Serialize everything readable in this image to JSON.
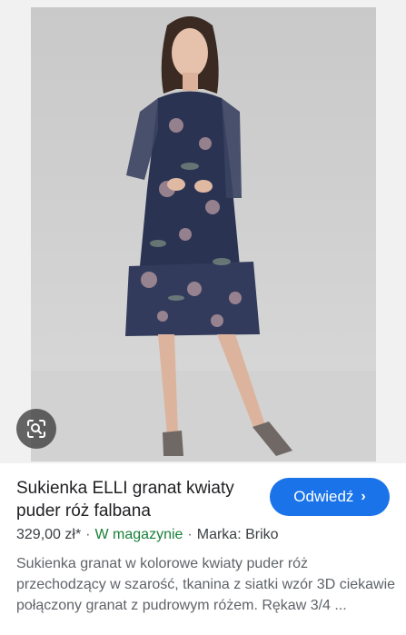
{
  "product": {
    "title": "Sukienka ELLI granat kwiaty puder róż falbana",
    "price": "329,00 zł*",
    "availability": "W magazynie",
    "brand": "Marka: Briko",
    "description": "Sukienka granat w kolorowe kwiaty puder róż przechodzący w szarość, tkanina z siatki wzór 3D ciekawie połączony granat z pudrowym różem. Rękaw 3/4 ...",
    "separator": "·"
  },
  "visit_button": {
    "label": "Odwiedź",
    "chevron": "›"
  },
  "lens_button": {
    "icon": "lens-search-icon"
  },
  "colors": {
    "accent": "#1a73e8",
    "stock": "#188038",
    "dress": "#2b3352",
    "background": "#cfcfcf"
  }
}
